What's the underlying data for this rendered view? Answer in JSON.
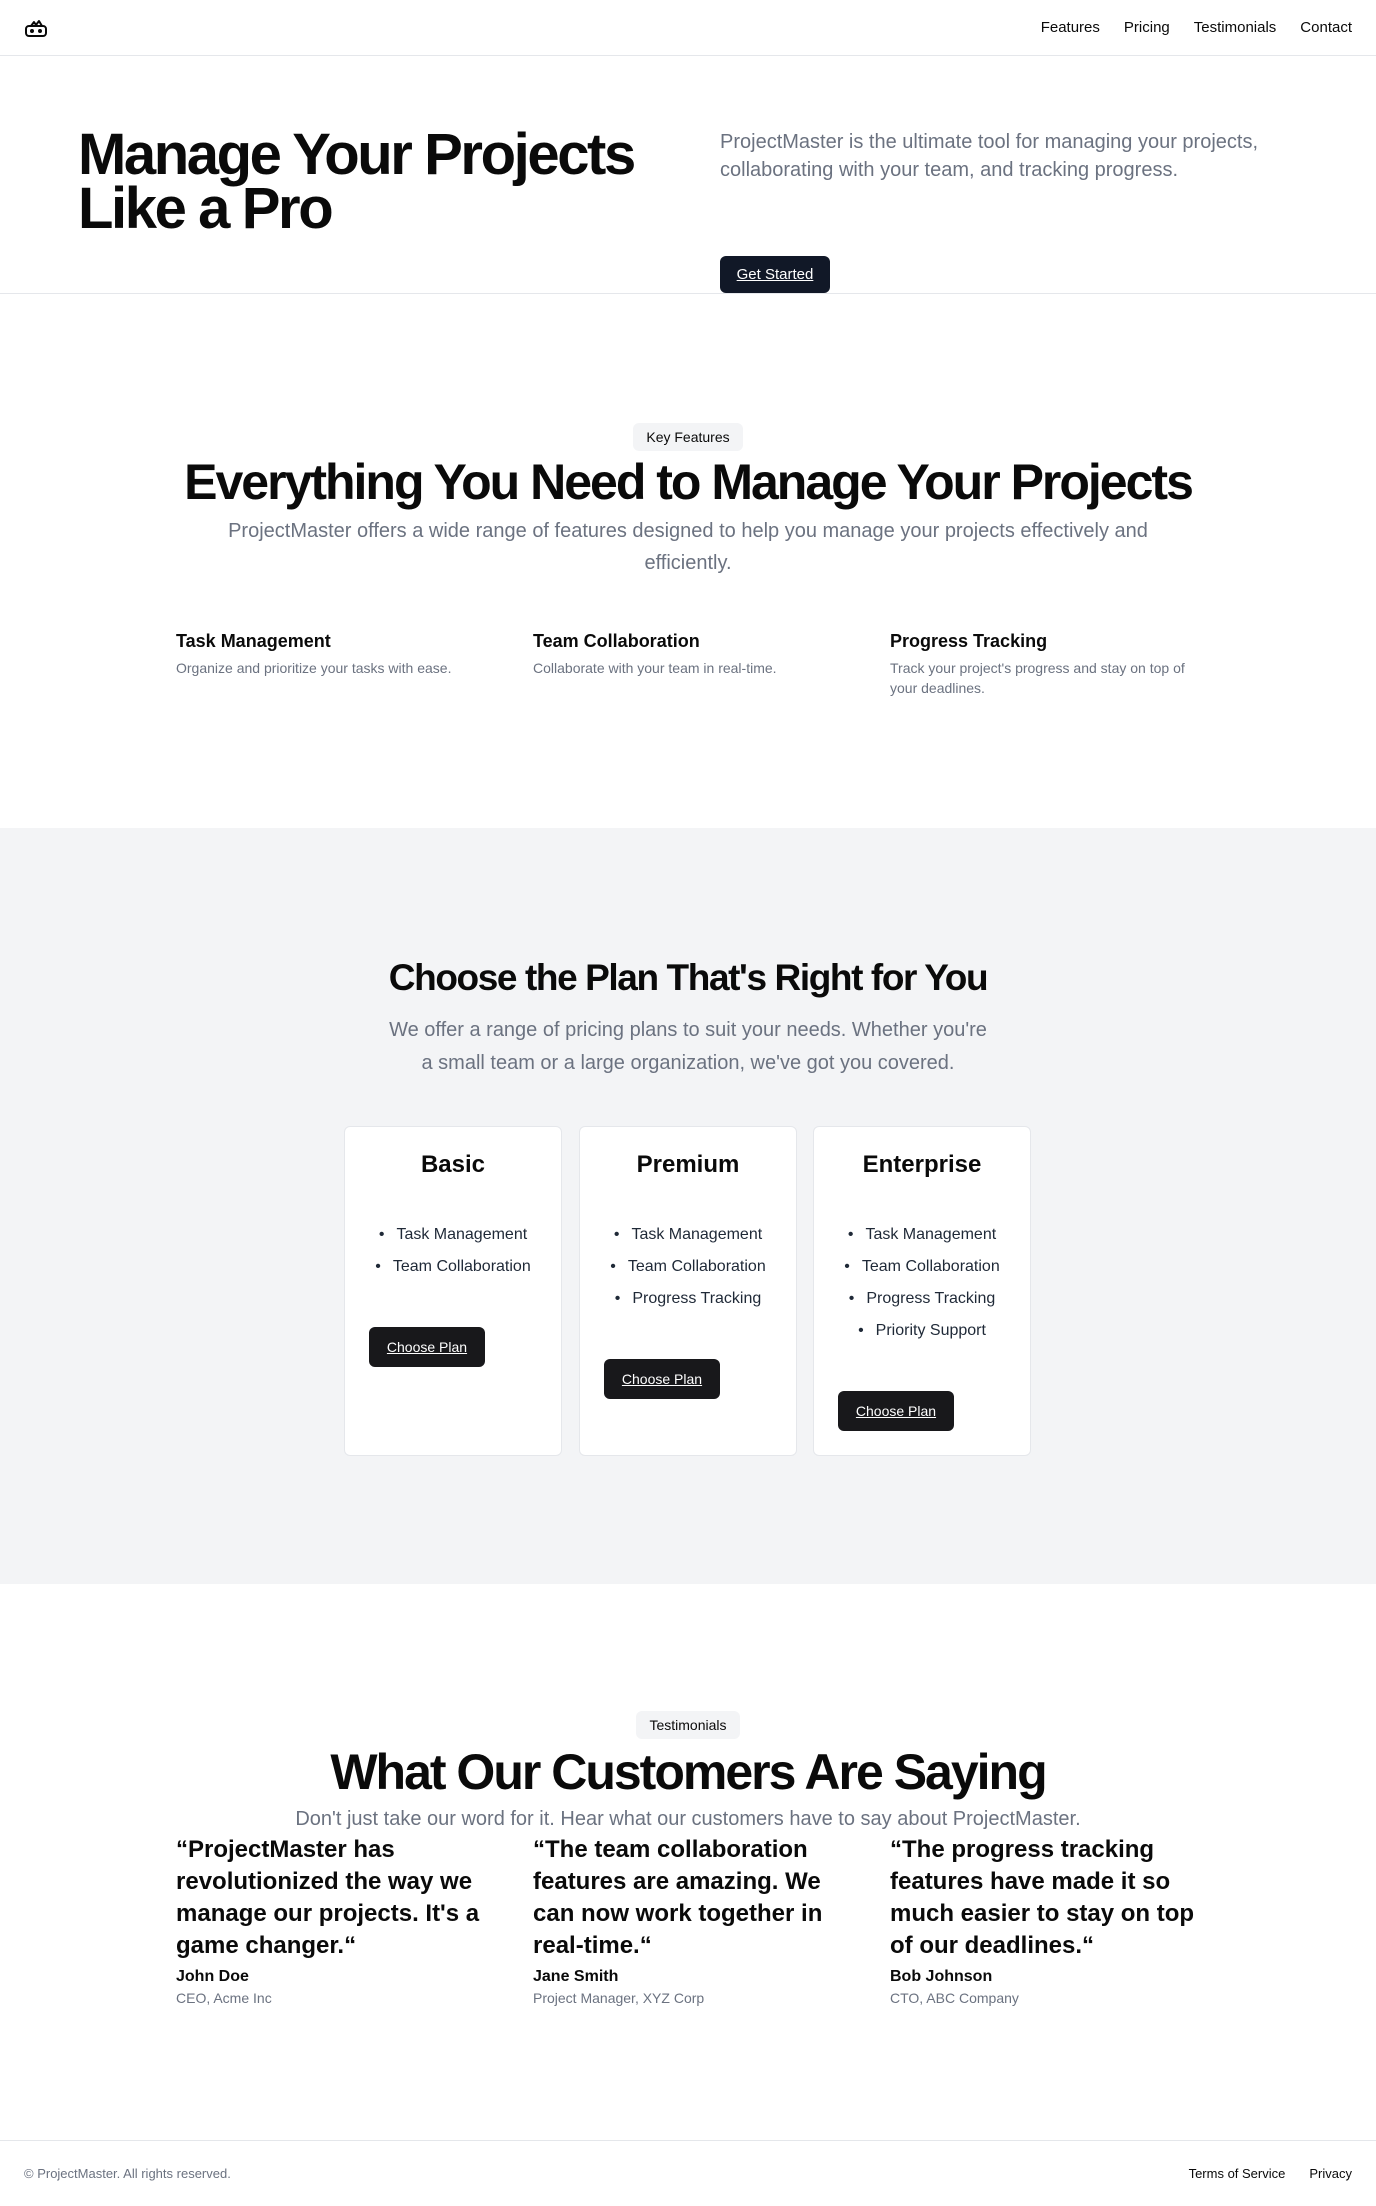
{
  "header": {
    "logo_icon": "mountain-logo-icon",
    "nav": [
      "Features",
      "Pricing",
      "Testimonials",
      "Contact"
    ]
  },
  "hero": {
    "title": "Manage Your Projects Like a Pro",
    "description": "ProjectMaster is the ultimate tool for managing your projects, collaborating with your team, and tracking progress.",
    "cta": "Get Started"
  },
  "features": {
    "badge": "Key Features",
    "title": "Everything You Need to Manage Your Projects",
    "subtitle": "ProjectMaster offers a wide range of features designed to help you manage your projects effectively and efficiently.",
    "items": [
      {
        "title": "Task Management",
        "description": "Organize and prioritize your tasks with ease."
      },
      {
        "title": "Team Collaboration",
        "description": "Collaborate with your team in real-time."
      },
      {
        "title": "Progress Tracking",
        "description": "Track your project's progress and stay on top of your deadlines."
      }
    ]
  },
  "pricing": {
    "title": "Choose the Plan That's Right for You",
    "subtitle": "We offer a range of pricing plans to suit your needs. Whether you're a small team or a large organization, we've got you covered.",
    "plans": [
      {
        "name": "Basic",
        "features": [
          "Task Management",
          "Team Collaboration"
        ],
        "button": "Choose Plan"
      },
      {
        "name": "Premium",
        "features": [
          "Task Management",
          "Team Collaboration",
          "Progress Tracking"
        ],
        "button": "Choose Plan"
      },
      {
        "name": "Enterprise",
        "features": [
          "Task Management",
          "Team Collaboration",
          "Progress Tracking",
          "Priority Support"
        ],
        "button": "Choose Plan"
      }
    ]
  },
  "testimonials": {
    "badge": "Testimonials",
    "title": "What Our Customers Are Saying",
    "subtitle": "Don't just take our word for it. Hear what our customers have to say about ProjectMaster.",
    "items": [
      {
        "quote": "“ProjectMaster has revolutionized the way we manage our projects. It's a game changer.“",
        "author": "John Doe",
        "role": "CEO, Acme Inc"
      },
      {
        "quote": "“The team collaboration features are amazing. We can now work together in real-time.“",
        "author": "Jane Smith",
        "role": "Project Manager, XYZ Corp"
      },
      {
        "quote": "“The progress tracking features have made it so much easier to stay on top of our deadlines.“",
        "author": "Bob Johnson",
        "role": "CTO, ABC Company"
      }
    ]
  },
  "footer": {
    "copyright": "© ProjectMaster. All rights reserved.",
    "links": [
      "Terms of Service",
      "Privacy"
    ]
  }
}
